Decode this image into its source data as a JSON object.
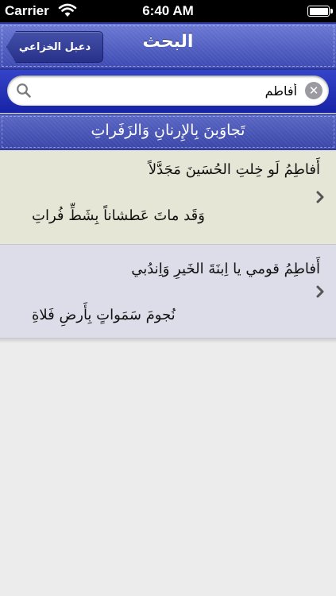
{
  "status_bar": {
    "carrier": "Carrier",
    "time": "6:40 AM"
  },
  "nav": {
    "back_label": "دعبل الخزاعي",
    "title": "البحث"
  },
  "search": {
    "value": "أفاطم",
    "clear_symbol": "✕"
  },
  "section": {
    "title": "تَجاوَبنَ بِالإِرنانِ وَالزَفَراتِ"
  },
  "results": [
    {
      "line1": "أَفاطِمُ لَو خِلتِ الحُسَينَ مَجَدَّلاً",
      "line2": "وَقَد ماتَ عَطشاناً بِشَطِّ فُراتِ"
    },
    {
      "line1": "أَفاطِمُ قومي يا اِبنَةَ الخَيرِ وَاِندُبي",
      "line2": "نُجومَ سَمَواتٍ بِأَرضِ فَلاةِ"
    }
  ],
  "colors": {
    "nav_accent": "#3c4ab2",
    "row_odd": "#e6e6d6",
    "row_even": "#dcdde8"
  }
}
